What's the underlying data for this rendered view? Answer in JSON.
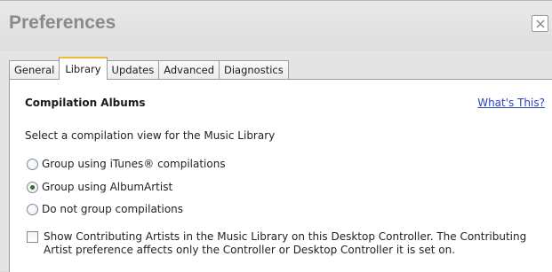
{
  "window": {
    "title": "Preferences",
    "close_icon": "close-icon"
  },
  "tabs": [
    {
      "label": "General",
      "active": false
    },
    {
      "label": "Library",
      "active": true
    },
    {
      "label": "Updates",
      "active": false
    },
    {
      "label": "Advanced",
      "active": false
    },
    {
      "label": "Diagnostics",
      "active": false
    }
  ],
  "library": {
    "section_title": "Compilation Albums",
    "help_link": "What's This?",
    "prompt": "Select a compilation view for the Music Library",
    "options": [
      {
        "label": "Group using iTunes® compilations",
        "checked": false
      },
      {
        "label": "Group using AlbumArtist",
        "checked": true
      },
      {
        "label": "Do not group compilations",
        "checked": false
      }
    ],
    "contributing_artists": {
      "label": "Show Contributing Artists in the Music Library on this Desktop Controller.  The Contributing Artist preference affects only the Controller or Desktop Controller it is set on.",
      "checked": false
    }
  },
  "colors": {
    "active_tab_accent": "#f4b93a",
    "link": "#2a43c6",
    "radio_dot": "#2e6b2a"
  }
}
